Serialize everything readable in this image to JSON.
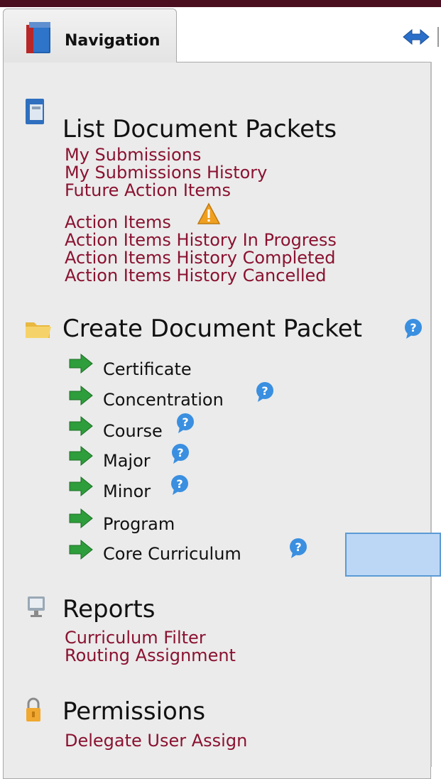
{
  "navigation": {
    "tab_label": "Navigation"
  },
  "list_packets": {
    "heading": "List Document Packets",
    "links": [
      "My Submissions",
      "My Submissions History",
      "Future Action Items",
      "Action Items",
      "Action Items History In Progress",
      "Action Items History Completed",
      "Action Items History Cancelled"
    ]
  },
  "create_packet": {
    "heading": "Create Document Packet",
    "items": [
      "Certificate",
      "Concentration",
      "Course",
      "Major",
      "Minor",
      "Program",
      "Core Curriculum"
    ]
  },
  "reports": {
    "heading": "Reports",
    "links": [
      "Curriculum Filter",
      "Routing Assignment"
    ]
  },
  "permissions": {
    "heading": "Permissions",
    "links": [
      "Delegate User Assign"
    ]
  },
  "colors": {
    "link": "#8a1230",
    "accent": "#4a1020",
    "arrow": "#2e9d3b",
    "help": "#3a8fe0",
    "warning": "#f0a020"
  }
}
